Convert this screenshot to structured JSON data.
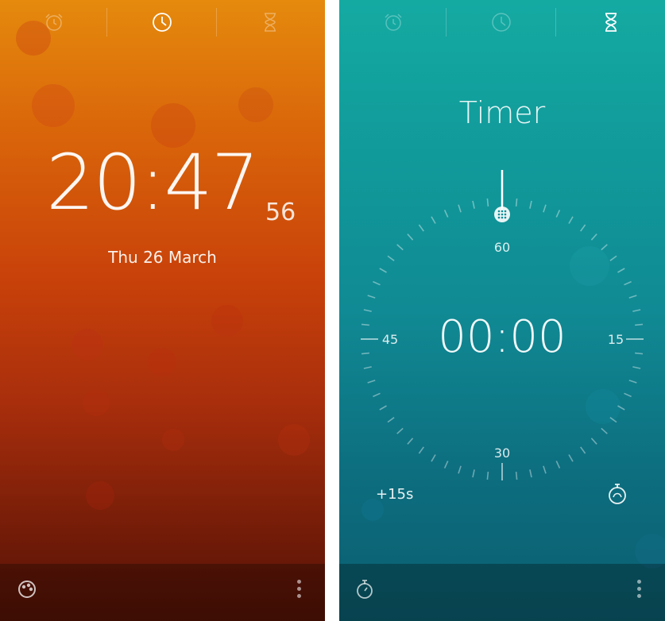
{
  "clock_screen": {
    "tabs": [
      {
        "icon": "alarm-icon",
        "active": false
      },
      {
        "icon": "clock-icon",
        "active": true
      },
      {
        "icon": "hourglass-icon",
        "active": false
      }
    ],
    "time": "20:47",
    "seconds": "56",
    "date": "Thu 26 March",
    "bottom": {
      "left_icon": "theme-palette-icon",
      "right_icon": "more-vertical-icon"
    },
    "colors": {
      "top": "#e58a0d",
      "bottom": "#551206"
    }
  },
  "timer_screen": {
    "tabs": [
      {
        "icon": "alarm-icon",
        "active": false
      },
      {
        "icon": "clock-icon",
        "active": false
      },
      {
        "icon": "hourglass-icon",
        "active": true
      }
    ],
    "title": "Timer",
    "readout": "00:00",
    "dial_labels": {
      "top": "60",
      "right": "15",
      "bottom": "30",
      "left": "45"
    },
    "add_button": "+15s",
    "bottom": {
      "left_icon": "stopwatch-icon",
      "right_icon": "more-vertical-icon"
    },
    "colors": {
      "top": "#14aaa2",
      "bottom": "#0a5d6e"
    }
  }
}
